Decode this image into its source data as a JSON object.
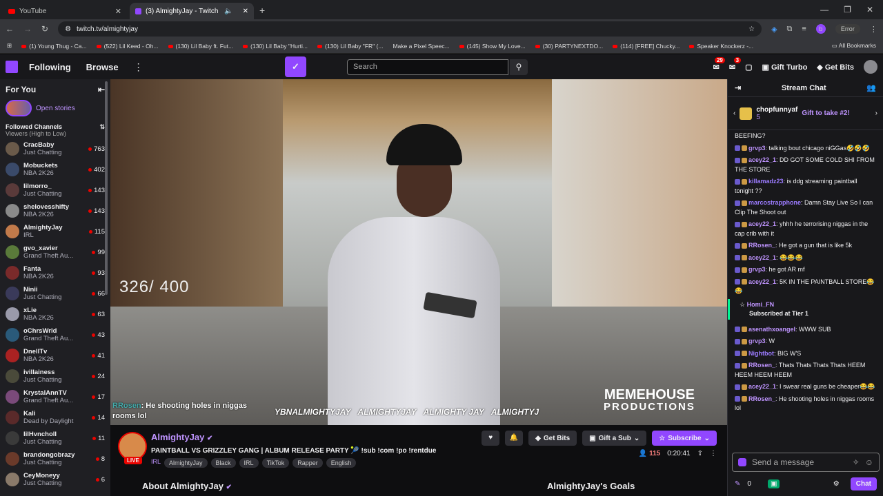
{
  "browser": {
    "tabs": [
      {
        "label": "YouTube",
        "active": false
      },
      {
        "label": "(3) AlmightyJay - Twitch",
        "active": true
      }
    ],
    "new_tab": "+",
    "url": "twitch.tv/almightyjay",
    "error_label": "Error",
    "profile_letter": "b",
    "bookmarks": [
      "(1) Young Thug - Ca...",
      "(522) Lil Keed - Oh...",
      "(130) Lil Baby ft. Fut...",
      "(130) Lil Baby \"Hurti...",
      "(130) Lil Baby \"FR\" (...",
      "Make a Pixel Speec...",
      "(145) Show My Love...",
      "(30) PARTYNEXTDO...",
      "(114) [FREE] Chucky...",
      "Speaker Knockerz -..."
    ],
    "all_bookmarks": "All Bookmarks"
  },
  "nav": {
    "following": "Following",
    "browse": "Browse",
    "search_placeholder": "Search",
    "inbox_count": "29",
    "whispers_count": "3",
    "gift_turbo": "Gift Turbo",
    "get_bits": "Get Bits"
  },
  "sidebar": {
    "for_you": "For You",
    "open_stories": "Open stories",
    "followed_channels": "Followed Channels",
    "sort": "Viewers (High to Low)",
    "channels": [
      {
        "name": "CracBaby",
        "game": "Just Chatting",
        "viewers": "763",
        "color": "#6a5a4a"
      },
      {
        "name": "Mobuckets",
        "game": "NBA 2K26",
        "viewers": "402",
        "color": "#3a4a6a"
      },
      {
        "name": "lilmorro_",
        "game": "Just Chatting",
        "viewers": "143",
        "color": "#5a3a3a"
      },
      {
        "name": "shelovesshifty",
        "game": "NBA 2K26",
        "viewers": "143",
        "color": "#8a8a8a"
      },
      {
        "name": "AlmightyJay",
        "game": "IRL",
        "viewers": "115",
        "color": "#c27a4a"
      },
      {
        "name": "gvo_xavier",
        "game": "Grand Theft Au...",
        "viewers": "99",
        "color": "#5a7a3a"
      },
      {
        "name": "Fanta",
        "game": "NBA 2K26",
        "viewers": "93",
        "color": "#7a2a2a"
      },
      {
        "name": "Ninii",
        "game": "Just Chatting",
        "viewers": "66",
        "color": "#3a3a5a"
      },
      {
        "name": "xLie",
        "game": "NBA 2K26",
        "viewers": "63",
        "color": "#9a9aaa"
      },
      {
        "name": "oChrsWrld",
        "game": "Grand Theft Au...",
        "viewers": "43",
        "color": "#2a5a7a"
      },
      {
        "name": "DnellTv",
        "game": "NBA 2K26",
        "viewers": "41",
        "color": "#aa2222"
      },
      {
        "name": "ivillainess",
        "game": "Just Chatting",
        "viewers": "24",
        "color": "#4a4a3a"
      },
      {
        "name": "KrystalAnnTV",
        "game": "Grand Theft Au...",
        "viewers": "17",
        "color": "#7a4a7a"
      },
      {
        "name": "Kali",
        "game": "Dead by Daylight",
        "viewers": "14",
        "color": "#5a2a2a"
      },
      {
        "name": "lilHvncholl",
        "game": "Just Chatting",
        "viewers": "11",
        "color": "#3a3a3a"
      },
      {
        "name": "brandongobrazy",
        "game": "Just Chatting",
        "viewers": "8",
        "color": "#6a3a2a"
      },
      {
        "name": "CeyMoneyy",
        "game": "Just Chatting",
        "viewers": "6",
        "color": "#8a7a6a"
      }
    ]
  },
  "video": {
    "counter": "326/ 400",
    "overlay_chat_user": "RRosen",
    "overlay_chat_text": ": He shooting holes in niggas rooms lol",
    "socials": [
      "YBNALMIGHTYJAY",
      "ALMIGHTYJAY",
      "ALMIGHTY JAY",
      "ALMIGHTYJ"
    ],
    "watermark_top": "MEMEHOUSE",
    "watermark_bottom": "PRODUCTIONS"
  },
  "stream": {
    "channel": "AlmightyJay",
    "live": "LIVE",
    "title": "PAINTBALL VS GRIZZLEY GANG | ALBUM RELEASE PARTY 🎾 !sub !com !po !rentdue",
    "category": "IRL",
    "tags": [
      "AlmightyJay",
      "Black",
      "IRL",
      "TikTok",
      "Rapper",
      "English"
    ],
    "get_bits": "Get Bits",
    "gift_sub": "Gift a Sub",
    "subscribe": "Subscribe",
    "viewers": "115",
    "uptime": "0:20:41",
    "about": "About AlmightyJay",
    "goals": "AlmightyJay's Goals"
  },
  "chat": {
    "title": "Stream Chat",
    "pinned_user": "chopfunnyaf",
    "pinned_count": "5",
    "pinned_text": "Gift to take #2!",
    "messages": [
      {
        "user": "",
        "text": "BEEFING?",
        "color": "#efeff1"
      },
      {
        "user": "grvp3",
        "text": ": talking bout chicago niGGas🤣🤣🤣",
        "color": "#bf94ff"
      },
      {
        "user": "acey22_1",
        "text": ": DD GOT SOME COLD SHI FROM THE STORE",
        "color": "#bf94ff"
      },
      {
        "user": "killamadz23",
        "text": ": is ddg streaming paintball tonight ??",
        "color": "#9b7bff"
      },
      {
        "user": "marcostrapphone",
        "text": ": Damn Stay Live So I can Clip The Shoot out",
        "color": "#9b7bff"
      },
      {
        "user": "acey22_1",
        "text": ": yhhh he terrorising niggas in the cap crib with it",
        "color": "#bf94ff"
      },
      {
        "user": "RRosen_",
        "text": ": He got a gun that is like 5k",
        "color": "#bf94ff"
      },
      {
        "user": "acey22_1",
        "text": ": 😂😂😂",
        "color": "#bf94ff"
      },
      {
        "user": "grvp3",
        "text": ": he got AR mf",
        "color": "#bf94ff"
      },
      {
        "user": "acey22_1",
        "text": ": 5K IN THE PAINTBALL STORE😂😂",
        "color": "#bf94ff"
      }
    ],
    "sub_user": "Homi_FN",
    "sub_text": "Subscribed at Tier 1",
    "messages2": [
      {
        "user": "asenathxoangel",
        "text": ": WWW SUB",
        "color": "#bf94ff"
      },
      {
        "user": "grvp3",
        "text": ": W",
        "color": "#bf94ff"
      },
      {
        "user": "Nightbot",
        "text": ": BIG W'S",
        "color": "#9b7bff"
      },
      {
        "user": "RRosen_",
        "text": ": Thats Thats Thats Thats HEEM HEEM HEEM HEEM",
        "color": "#bf94ff"
      },
      {
        "user": "acey22_1",
        "text": ": I swear real guns be cheaper😂😂",
        "color": "#bf94ff"
      },
      {
        "user": "RRosen_",
        "text": ": He shooting holes in niggas rooms lol",
        "color": "#bf94ff"
      }
    ],
    "input_placeholder": "Send a message",
    "points": "0",
    "chat_button": "Chat"
  }
}
